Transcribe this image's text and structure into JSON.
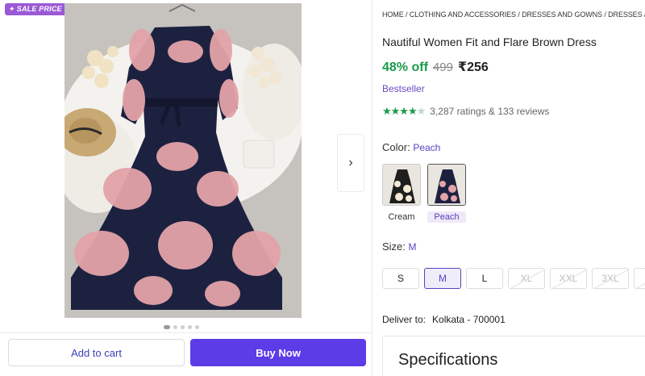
{
  "badge": {
    "text": "SALE PRICE"
  },
  "gallery": {
    "dot_count": 5,
    "active_index": 0
  },
  "actions": {
    "add_to_cart": "Add to cart",
    "buy_now": "Buy Now"
  },
  "breadcrumb": "HOME / CLOTHING AND ACCESSORIES / DRESSES AND GOWNS / DRESSES / WOMEN",
  "product": {
    "title": "Nautiful Women Fit and Flare Brown Dress",
    "discount": "48% off",
    "mrp": "499",
    "price": "₹256",
    "tag": "Bestseller",
    "rating_value": 4.5,
    "ratings_text": "3,287 ratings  & 133 reviews"
  },
  "color": {
    "label": "Color:",
    "selected": "Peach",
    "options": [
      "Cream",
      "Peach"
    ]
  },
  "size": {
    "label": "Size:",
    "selected": "M",
    "options": [
      {
        "label": "S",
        "state": "available"
      },
      {
        "label": "M",
        "state": "selected"
      },
      {
        "label": "L",
        "state": "available"
      },
      {
        "label": "XL",
        "state": "disabled"
      },
      {
        "label": "XXL",
        "state": "disabled"
      },
      {
        "label": "3XL",
        "state": "disabled"
      }
    ]
  },
  "delivery": {
    "label": "Deliver to:",
    "location": "Kolkata - 700001"
  },
  "specifications": {
    "title": "Specifications"
  },
  "colors": {
    "accent": "#5c3ce6",
    "discount_green": "#1b9a4b",
    "badge": "#9b59d6"
  }
}
